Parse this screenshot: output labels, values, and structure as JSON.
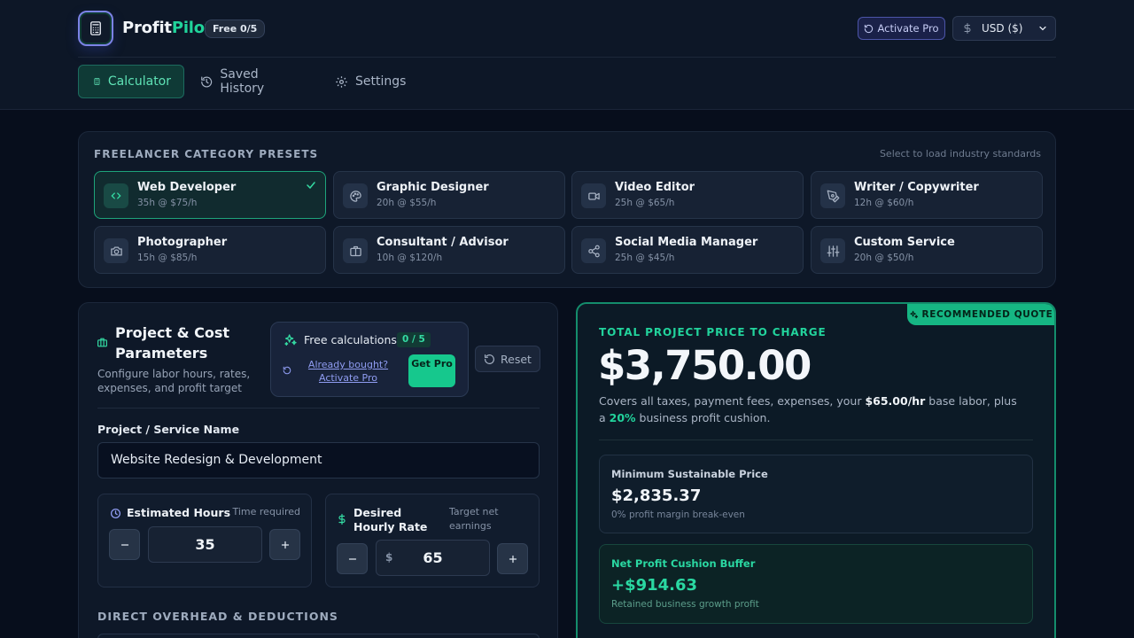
{
  "brand": {
    "part1": "Profit",
    "part2": "Pilot",
    "badge": "Free 0/5"
  },
  "header": {
    "activate_pro": "Activate Pro",
    "currency": "USD ($)"
  },
  "nav": {
    "tabs": [
      {
        "label": "Calculator"
      },
      {
        "label": "Saved History"
      },
      {
        "label": "Settings"
      }
    ]
  },
  "presets": {
    "title": "FREELANCER CATEGORY PRESETS",
    "hint": "Select to load industry standards",
    "items": [
      {
        "name": "Web Developer",
        "sub": "35h @ $75/h",
        "icon": "code-icon"
      },
      {
        "name": "Graphic Designer",
        "sub": "20h @ $55/h",
        "icon": "palette-icon"
      },
      {
        "name": "Video Editor",
        "sub": "25h @ $65/h",
        "icon": "video-icon"
      },
      {
        "name": "Writer / Copywriter",
        "sub": "12h @ $60/h",
        "icon": "pen-icon"
      },
      {
        "name": "Photographer",
        "sub": "15h @ $85/h",
        "icon": "camera-icon"
      },
      {
        "name": "Consultant / Advisor",
        "sub": "10h @ $120/h",
        "icon": "briefcase-icon"
      },
      {
        "name": "Social Media Manager",
        "sub": "25h @ $45/h",
        "icon": "share-icon"
      },
      {
        "name": "Custom Service",
        "sub": "20h @ $50/h",
        "icon": "sliders-icon"
      }
    ]
  },
  "params": {
    "title": "Project & Cost Parameters",
    "desc": "Configure labor hours, rates, expenses, and profit target",
    "free_label": "Free calculations:",
    "free_count": "0 / 5",
    "already_link": "Already bought? Activate Pro",
    "get_pro": "Get Pro",
    "reset": "Reset",
    "project_label": "Project / Service Name",
    "project_value": "Website Redesign & Development",
    "hours_title": "Estimated Hours",
    "hours_hint": "Time required",
    "hours_value": "35",
    "rate_title": "Desired Hourly Rate",
    "rate_hint": "Target net earnings",
    "rate_prefix": "$",
    "rate_value": "65",
    "overhead_title": "DIRECT OVERHEAD & DEDUCTIONS"
  },
  "quote": {
    "tag": "RECOMMENDED QUOTE",
    "total_label": "TOTAL PROJECT PRICE TO CHARGE",
    "total_price": "$3,750.00",
    "desc_a": "Covers all taxes, payment fees, expenses, your ",
    "desc_rate": "$65.00/hr",
    "desc_b": " base labor, plus a ",
    "desc_pct": "20%",
    "desc_c": " business profit cushion.",
    "min_label": "Minimum Sustainable Price",
    "min_value": "$2,835.37",
    "min_sub": "0% profit margin break-even",
    "net_label": "Net Profit Cushion Buffer",
    "net_value": "+$914.63",
    "net_sub": "Retained business growth profit"
  },
  "colors": {
    "accent": "#20d39a",
    "pro": "#7c83e6",
    "bg": "#070e1c"
  }
}
